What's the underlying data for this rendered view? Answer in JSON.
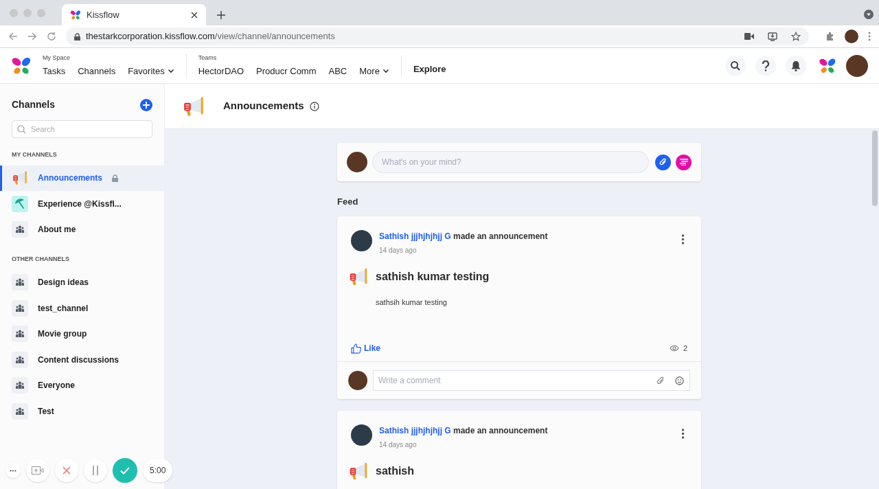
{
  "browser": {
    "tab_title": "Kissflow",
    "url_host": "thestarkcorporation.kissflow.com",
    "url_path": "/view/channel/announcements"
  },
  "header": {
    "groups": [
      {
        "label": "My Space",
        "items": [
          {
            "label": "Tasks",
            "dropdown": false
          },
          {
            "label": "Channels",
            "dropdown": false
          },
          {
            "label": "Favorites",
            "dropdown": true
          }
        ]
      },
      {
        "label": "Teams",
        "items": [
          {
            "label": "HectorDAO",
            "dropdown": false
          },
          {
            "label": "Producr Comm",
            "dropdown": false
          },
          {
            "label": "ABC",
            "dropdown": false
          },
          {
            "label": "More",
            "dropdown": true
          }
        ]
      }
    ],
    "explore": "Explore"
  },
  "sidebar": {
    "title": "Channels",
    "search_placeholder": "Search",
    "sections": [
      {
        "heading": "MY CHANNELS",
        "channels": [
          {
            "name": "Announcements",
            "kind": "megaphone",
            "selected": true,
            "locked": true
          },
          {
            "name": "Experience @Kissfl...",
            "kind": "umbrella",
            "selected": false,
            "locked": false
          },
          {
            "name": "About me",
            "kind": "group",
            "selected": false,
            "locked": false
          }
        ]
      },
      {
        "heading": "OTHER CHANNELS",
        "channels": [
          {
            "name": "Design ideas",
            "kind": "group",
            "selected": false,
            "locked": false
          },
          {
            "name": "test_channel",
            "kind": "group",
            "selected": false,
            "locked": false
          },
          {
            "name": "Movie group",
            "kind": "group",
            "selected": false,
            "locked": false
          },
          {
            "name": "Content discussions",
            "kind": "group",
            "selected": false,
            "locked": false
          },
          {
            "name": "Everyone",
            "kind": "group",
            "selected": false,
            "locked": false
          },
          {
            "name": "Test",
            "kind": "group",
            "selected": false,
            "locked": false
          }
        ]
      }
    ]
  },
  "main": {
    "title": "Announcements",
    "composer_placeholder": "What's on your mind?",
    "feed_heading": "Feed",
    "posts": [
      {
        "author": "Sathish jjjhjhjhjj G",
        "action": "made an announcement",
        "time": "14 days ago",
        "title": "sathish kumar testing",
        "body": "sathsih kumar testing",
        "like": "Like",
        "views": "2",
        "comment_placeholder": "Write a comment"
      },
      {
        "author": "Sathish jjjhjhjhjj G",
        "action": "made an announcement",
        "time": "14 days ago",
        "title": "sathish"
      }
    ]
  },
  "recorder": {
    "timer": "5:00"
  }
}
